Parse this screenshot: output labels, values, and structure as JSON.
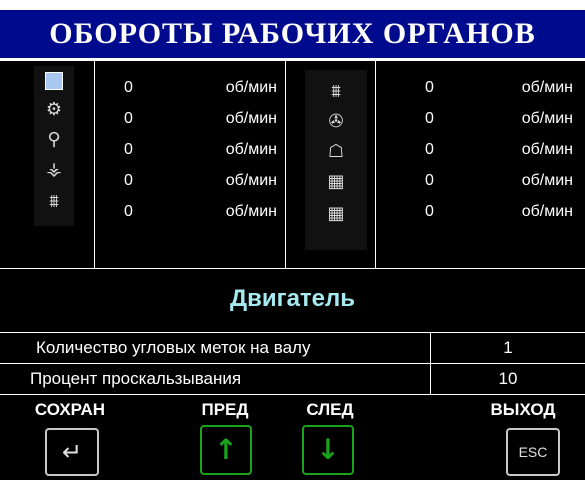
{
  "title": "ОБОРОТЫ РАБОЧИХ ОРГАНОВ",
  "speeds": {
    "left": [
      {
        "value": "0",
        "unit": "об/мин",
        "icon": "screen-icon"
      },
      {
        "value": "0",
        "unit": "об/мин",
        "icon": "reel-icon"
      },
      {
        "value": "0",
        "unit": "об/мин",
        "icon": "auger-icon"
      },
      {
        "value": "0",
        "unit": "об/мин",
        "icon": "thresher-icon"
      },
      {
        "value": "0",
        "unit": "об/мин",
        "icon": "cutter-icon"
      }
    ],
    "right": [
      {
        "value": "0",
        "unit": "об/мин",
        "icon": "header-icon"
      },
      {
        "value": "0",
        "unit": "об/мин",
        "icon": "fan-icon"
      },
      {
        "value": "0",
        "unit": "об/мин",
        "icon": "chopper-icon"
      },
      {
        "value": "0",
        "unit": "об/мин",
        "icon": "sieve-icon"
      },
      {
        "value": "0",
        "unit": "об/мин",
        "icon": "sieve-lower-icon"
      }
    ]
  },
  "motor": {
    "title": "Двигатель",
    "params": [
      {
        "label": "Количество угловых меток на валу",
        "value": "1"
      },
      {
        "label": "Процент проскальзывания",
        "value": "10"
      }
    ]
  },
  "buttons": {
    "save": {
      "label": "СОХРАН",
      "key": "↵",
      "icon": "enter-icon"
    },
    "prev": {
      "label": "ПРЕД",
      "key": "↑",
      "icon": "arrow-up-icon"
    },
    "next": {
      "label": "СЛЕД",
      "key": "↓",
      "icon": "arrow-down-icon"
    },
    "exit": {
      "label": "ВЫХОД",
      "key": "ESC",
      "icon": "esc-icon"
    }
  },
  "colors": {
    "title_bg": "#000a8c",
    "motor_title": "#a6e9ef",
    "green_key": "#1ba21b"
  }
}
